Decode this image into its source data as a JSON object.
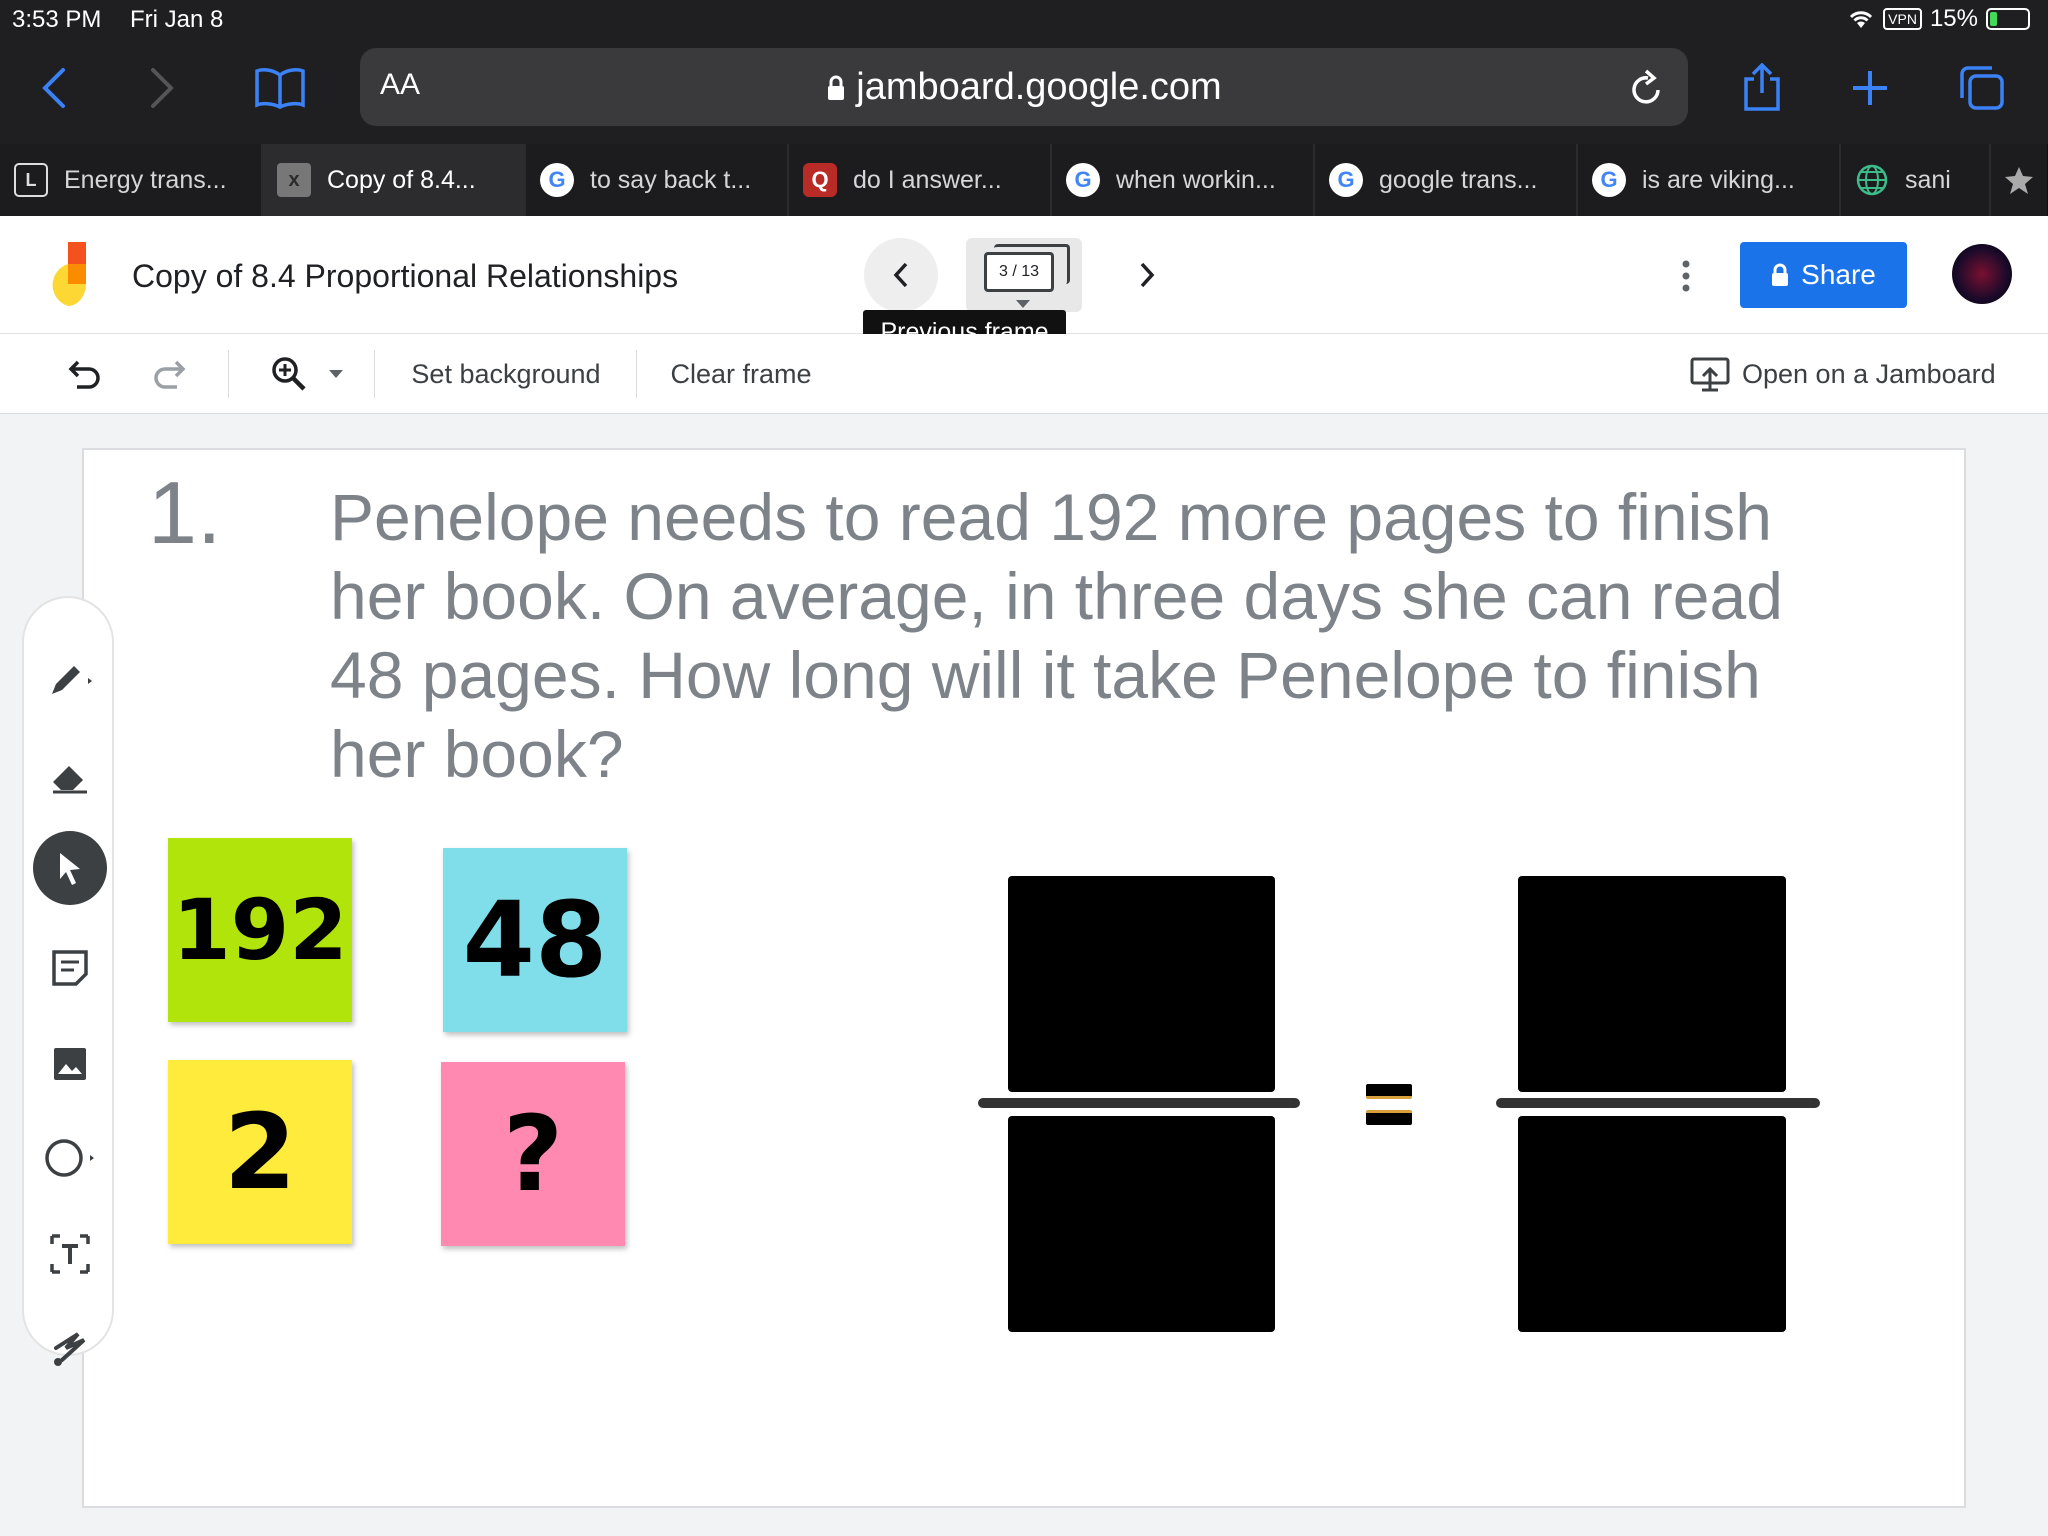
{
  "status": {
    "time": "3:53 PM",
    "date": "Fri Jan 8",
    "vpn": "VPN",
    "battery": "15%"
  },
  "browser": {
    "text_size": "AA",
    "url": "jamboard.google.com"
  },
  "tabs": [
    {
      "label": "Energy trans...",
      "icon": "L"
    },
    {
      "label": "Copy of 8.4...",
      "icon": "x"
    },
    {
      "label": "to say back t...",
      "icon": "G"
    },
    {
      "label": "do I answer...",
      "icon": "Q"
    },
    {
      "label": "when workin...",
      "icon": "G"
    },
    {
      "label": "google trans...",
      "icon": "G"
    },
    {
      "label": "is are viking...",
      "icon": "G"
    },
    {
      "label": "sani",
      "icon": "globe"
    }
  ],
  "header": {
    "title": "Copy of 8.4 Proportional Relationships",
    "frame_count": "3 / 13",
    "tooltip": "Previous frame",
    "share_label": "Share"
  },
  "toolbar": {
    "set_background": "Set background",
    "clear_frame": "Clear frame",
    "open_on_jamboard": "Open on a Jamboard"
  },
  "frame": {
    "number": "1.",
    "question": "Penelope needs to read 192 more pages to finish her book.  On average, in three days she can read 48 pages.  How long will it take Penelope to finish her book?",
    "notes": [
      {
        "text": "192",
        "color": "#b0e40a"
      },
      {
        "text": "48",
        "color": "#80deea"
      },
      {
        "text": "2",
        "color": "#ffeb3b"
      },
      {
        "text": "?",
        "color": "#ff89b0"
      }
    ],
    "equals": "="
  }
}
